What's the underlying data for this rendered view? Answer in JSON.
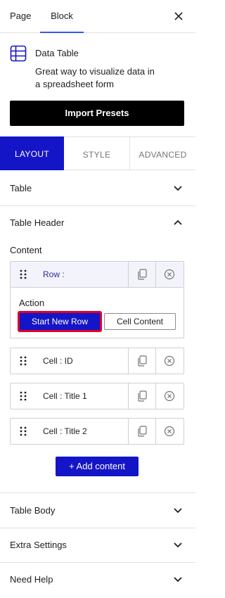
{
  "header": {
    "tabs": [
      {
        "label": "Page",
        "active": false
      },
      {
        "label": "Block",
        "active": true
      }
    ],
    "close_icon": "close-icon",
    "accent_color": "#3858e9"
  },
  "block": {
    "icon": "table-grid-icon",
    "title": "Data Table",
    "description": "Great way to visualize data in a spreadsheet form",
    "import_label": "Import Presets"
  },
  "mode_tabs": [
    {
      "label": "LAYOUT",
      "active": true
    },
    {
      "label": "STYLE",
      "active": false
    },
    {
      "label": "ADVANCED",
      "active": false
    }
  ],
  "sections": {
    "table": {
      "label": "Table",
      "expanded": false
    },
    "table_header": {
      "label": "Table Header",
      "expanded": true
    },
    "table_body": {
      "label": "Table Body",
      "expanded": false
    },
    "extra_settings": {
      "label": "Extra Settings",
      "expanded": false
    },
    "need_help": {
      "label": "Need Help",
      "expanded": false
    }
  },
  "content": {
    "label": "Content",
    "items": [
      {
        "label": "Row :",
        "expanded": true
      },
      {
        "label": "Cell : ID"
      },
      {
        "label": "Cell : Title 1"
      },
      {
        "label": "Cell : Title 2"
      }
    ],
    "action": {
      "label": "Action",
      "options": [
        "Start New Row",
        "Cell Content"
      ],
      "selected": "Start New Row"
    },
    "add_label": "+ Add content"
  },
  "colors": {
    "primary": "#1515c8",
    "highlight_outline": "#e0002a",
    "border": "#e0e0e0"
  }
}
